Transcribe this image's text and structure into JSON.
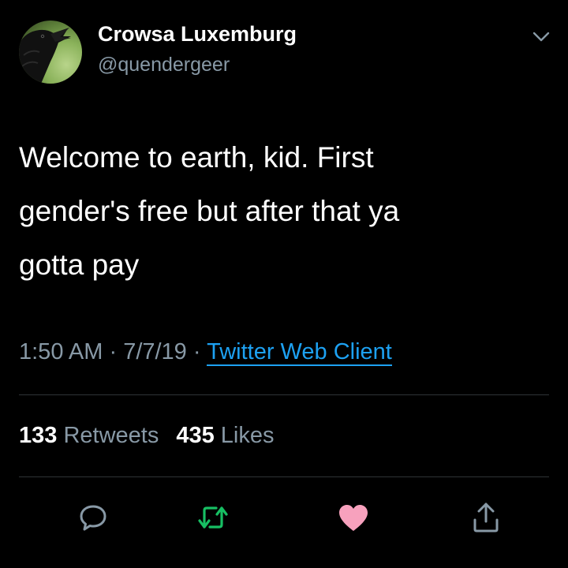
{
  "user": {
    "display_name": "Crowsa Luxemburg",
    "handle": "@quendergeer",
    "avatar": "crow-avatar"
  },
  "tweet": {
    "text_lines": [
      "Welcome to earth, kid. First",
      "gender's free but after that ya",
      "gotta pay"
    ],
    "time": "1:50 AM",
    "date": "7/7/19",
    "separator": "·",
    "source": "Twitter Web Client"
  },
  "stats": {
    "retweets_count": "133",
    "retweets_label": "Retweets",
    "likes_count": "435",
    "likes_label": "Likes"
  },
  "actions": [
    {
      "icon": "reply-icon",
      "color": "#8899a6"
    },
    {
      "icon": "retweet-icon",
      "color": "#17bf63"
    },
    {
      "icon": "heart-icon",
      "color": "#f7a1bd"
    },
    {
      "icon": "share-icon",
      "color": "#8899a6"
    }
  ],
  "colors": {
    "background": "#000000",
    "text_primary": "#ffffff",
    "text_secondary": "#8899a6",
    "link": "#1da1f2",
    "retweet_active": "#17bf63",
    "like_active": "#f7a1bd",
    "divider": "#2f3336"
  }
}
